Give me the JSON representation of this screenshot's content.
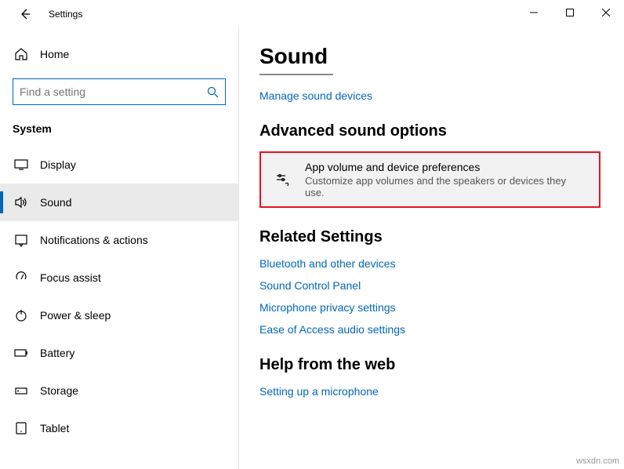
{
  "window": {
    "title": "Settings"
  },
  "sidebar": {
    "home": "Home",
    "search_placeholder": "Find a setting",
    "category": "System",
    "items": [
      {
        "label": "Display"
      },
      {
        "label": "Sound"
      },
      {
        "label": "Notifications & actions"
      },
      {
        "label": "Focus assist"
      },
      {
        "label": "Power & sleep"
      },
      {
        "label": "Battery"
      },
      {
        "label": "Storage"
      },
      {
        "label": "Tablet"
      }
    ]
  },
  "main": {
    "title": "Sound",
    "manage_link": "Manage sound devices",
    "adv_heading": "Advanced sound options",
    "card_title": "App volume and device preferences",
    "card_sub": "Customize app volumes and the speakers or devices they use.",
    "related_heading": "Related Settings",
    "related_links": [
      "Bluetooth and other devices",
      "Sound Control Panel",
      "Microphone privacy settings",
      "Ease of Access audio settings"
    ],
    "help_heading": "Help from the web",
    "help_link": "Setting up a microphone"
  },
  "watermark": "wsxdn.com"
}
